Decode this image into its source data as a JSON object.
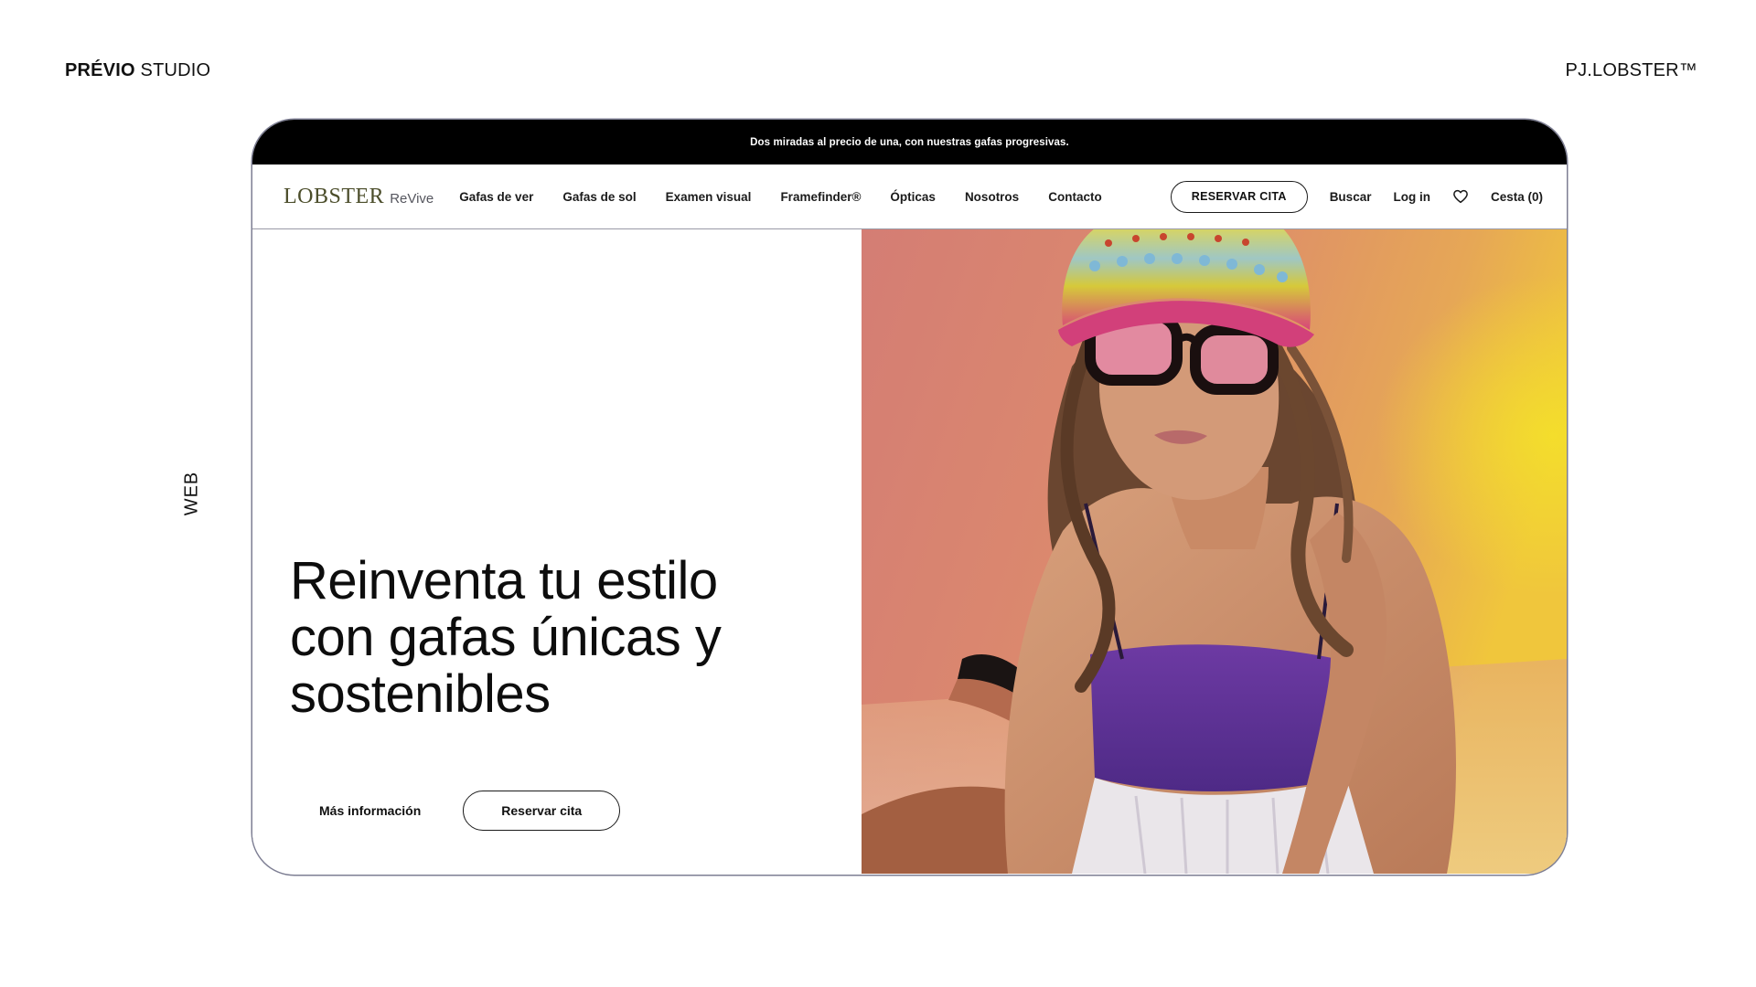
{
  "frame": {
    "studio_bold": "PRÉVIO",
    "studio_rest": " STUDIO",
    "client": "PJ.LOBSTER™",
    "side_label": "WEB"
  },
  "announcement": "Dos miradas al precio de una, con nuestras gafas progresivas.",
  "nav": {
    "logo_main": "LOBSTER",
    "logo_sub": "ReVive",
    "menu": [
      {
        "label": "Gafas de ver"
      },
      {
        "label": "Gafas de sol"
      },
      {
        "label": "Examen visual"
      },
      {
        "label": "Framefinder®"
      },
      {
        "label": "Ópticas"
      },
      {
        "label": "Nosotros"
      },
      {
        "label": "Contacto"
      }
    ],
    "cta": "RESERVAR CITA",
    "search": "Buscar",
    "login": "Log in",
    "wishlist_icon": "heart-icon",
    "cart": "Cesta (0)"
  },
  "hero": {
    "title_line1": "Reinventa tu estilo",
    "title_line2": "con gafas únicas y",
    "title_line3": "sostenibles",
    "more_label": "Más información",
    "book_label": "Reservar cita",
    "image_subject": "model-photo"
  },
  "colors": {
    "announce_bg": "#000000",
    "logo": "#4b4d2a",
    "photo_bg_left": "#d98478",
    "photo_bg_right": "#e9b44a"
  }
}
